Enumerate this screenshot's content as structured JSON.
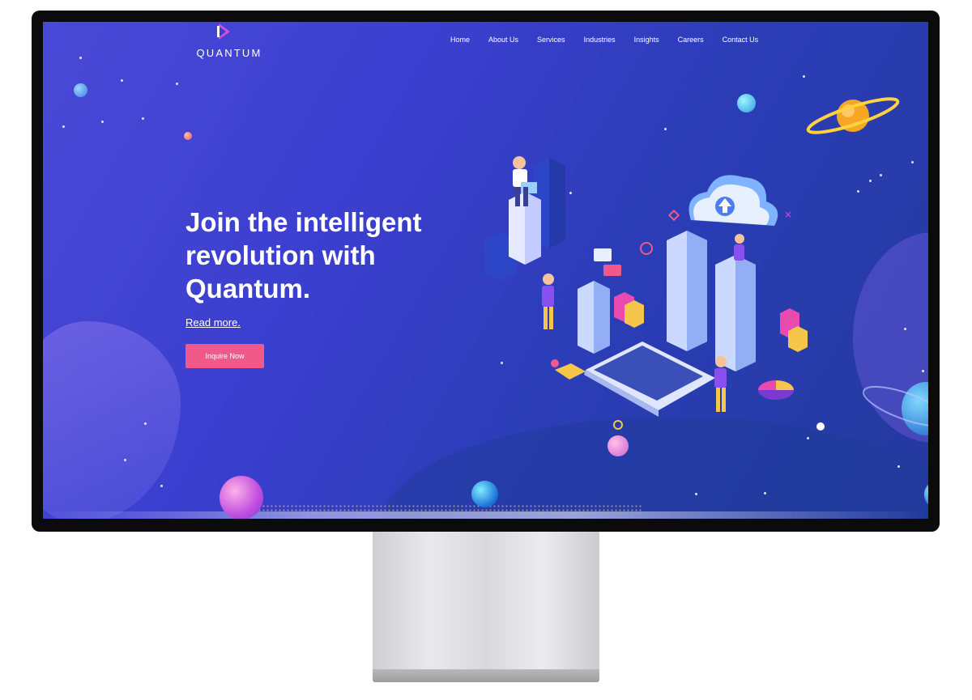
{
  "brand": {
    "name": "QUANTUM"
  },
  "nav": {
    "items": [
      {
        "label": "Home"
      },
      {
        "label": "About Us"
      },
      {
        "label": "Services"
      },
      {
        "label": "Industries"
      },
      {
        "label": "Insights"
      },
      {
        "label": "Careers"
      },
      {
        "label": "Contact Us"
      }
    ]
  },
  "hero": {
    "title_line1": "Join the intelligent",
    "title_line2": "revolution with",
    "title_line3": "Quantum.",
    "read_more": "Read more.",
    "cta_label": "Inquire Now"
  },
  "colors": {
    "background_start": "#4a49d6",
    "background_end": "#233a9e",
    "cta": "#f0598a",
    "text": "#ffffff"
  },
  "icons": [
    "quantum-logo-icon",
    "cloud-upload-icon",
    "server-rack-icon",
    "laptop-icon",
    "planet-icon",
    "mail-icon"
  ]
}
